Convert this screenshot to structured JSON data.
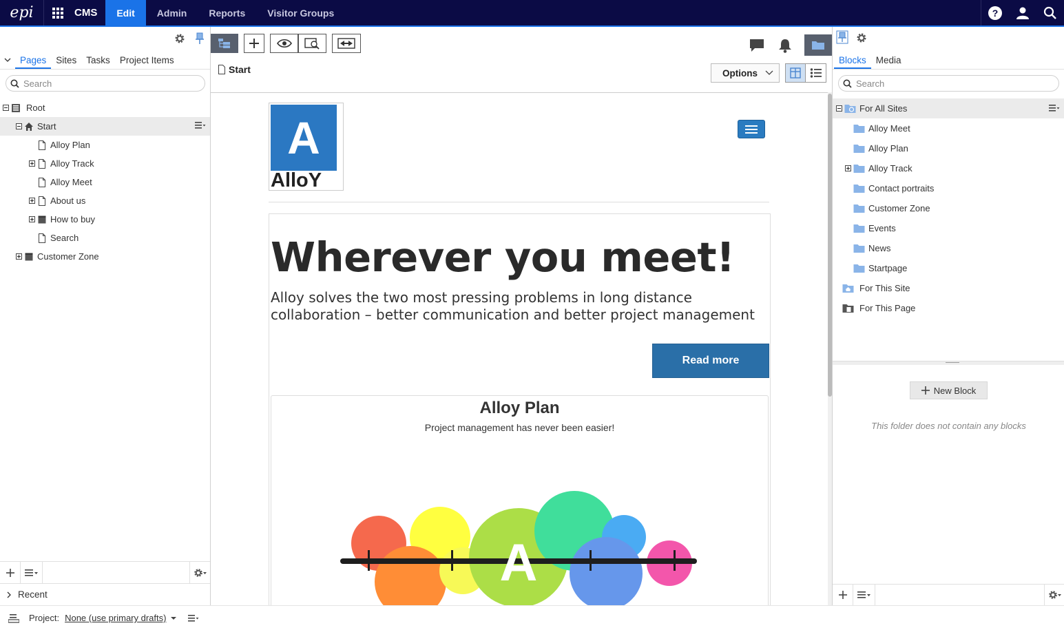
{
  "app": {
    "logo_text": "epi",
    "product": "CMS",
    "nav": [
      {
        "label": "Edit",
        "active": true
      },
      {
        "label": "Admin"
      },
      {
        "label": "Reports"
      },
      {
        "label": "Visitor Groups"
      }
    ],
    "icons": [
      "help-icon",
      "user-icon",
      "search-icon"
    ],
    "colors": {
      "topbar": "#0b0b45",
      "accent": "#1a73e8"
    }
  },
  "left_pane": {
    "tabs": [
      "Pages",
      "Sites",
      "Tasks",
      "Project Items"
    ],
    "active_tab": "Pages",
    "search_placeholder": "Search",
    "tree": [
      {
        "label": "Root",
        "level": 0,
        "expander": "minus",
        "icon": "root-icon"
      },
      {
        "label": "Start",
        "level": 1,
        "expander": "minus",
        "icon": "home-icon",
        "selected": true
      },
      {
        "label": "Alloy Plan",
        "level": 2,
        "expander": "none",
        "icon": "page-icon"
      },
      {
        "label": "Alloy Track",
        "level": 2,
        "expander": "plus",
        "icon": "page-icon"
      },
      {
        "label": "Alloy Meet",
        "level": 2,
        "expander": "none",
        "icon": "page-icon"
      },
      {
        "label": "About us",
        "level": 2,
        "expander": "plus",
        "icon": "page-icon"
      },
      {
        "label": "How to buy",
        "level": 2,
        "expander": "plus",
        "icon": "container-icon"
      },
      {
        "label": "Search",
        "level": 2,
        "expander": "none",
        "icon": "page-icon"
      },
      {
        "label": "Customer Zone",
        "level": 1,
        "expander": "plus",
        "icon": "container-icon"
      }
    ],
    "recent_label": "Recent"
  },
  "editor": {
    "breadcrumb": "Start",
    "options_label": "Options",
    "site": {
      "logo_letter": "A",
      "logo_word": "AlloY",
      "hero_title": "Wherever you meet!",
      "hero_text": "Alloy solves the two most pressing problems in long distance collaboration – better communication and better project management",
      "read_more": "Read more",
      "teaser_title": "Alloy Plan",
      "teaser_text": "Project management has never been easier!",
      "brand_color": "#2b78c2"
    }
  },
  "right_pane": {
    "tabs": [
      "Blocks",
      "Media"
    ],
    "active_tab": "Blocks",
    "search_placeholder": "Search",
    "tree": [
      {
        "label": "For All Sites",
        "icon": "global-folder-icon",
        "expander": "minus",
        "selected": true
      },
      {
        "label": "Alloy Meet",
        "icon": "folder-icon",
        "expander": "none"
      },
      {
        "label": "Alloy Plan",
        "icon": "folder-icon",
        "expander": "none"
      },
      {
        "label": "Alloy Track",
        "icon": "folder-icon",
        "expander": "plus"
      },
      {
        "label": "Contact portraits",
        "icon": "folder-icon",
        "expander": "none"
      },
      {
        "label": "Customer Zone",
        "icon": "folder-icon",
        "expander": "none"
      },
      {
        "label": "Events",
        "icon": "folder-icon",
        "expander": "none"
      },
      {
        "label": "News",
        "icon": "folder-icon",
        "expander": "none"
      },
      {
        "label": "Startpage",
        "icon": "folder-icon",
        "expander": "none"
      },
      {
        "label": "For This Site",
        "icon": "site-folder-icon",
        "expander": "root"
      },
      {
        "label": "For This Page",
        "icon": "page-folder-icon",
        "expander": "root"
      }
    ],
    "new_block_label": "New Block",
    "empty_message": "This folder does not contain any blocks"
  },
  "status_bar": {
    "project_label": "Project:",
    "project_value": "None (use primary drafts)"
  }
}
